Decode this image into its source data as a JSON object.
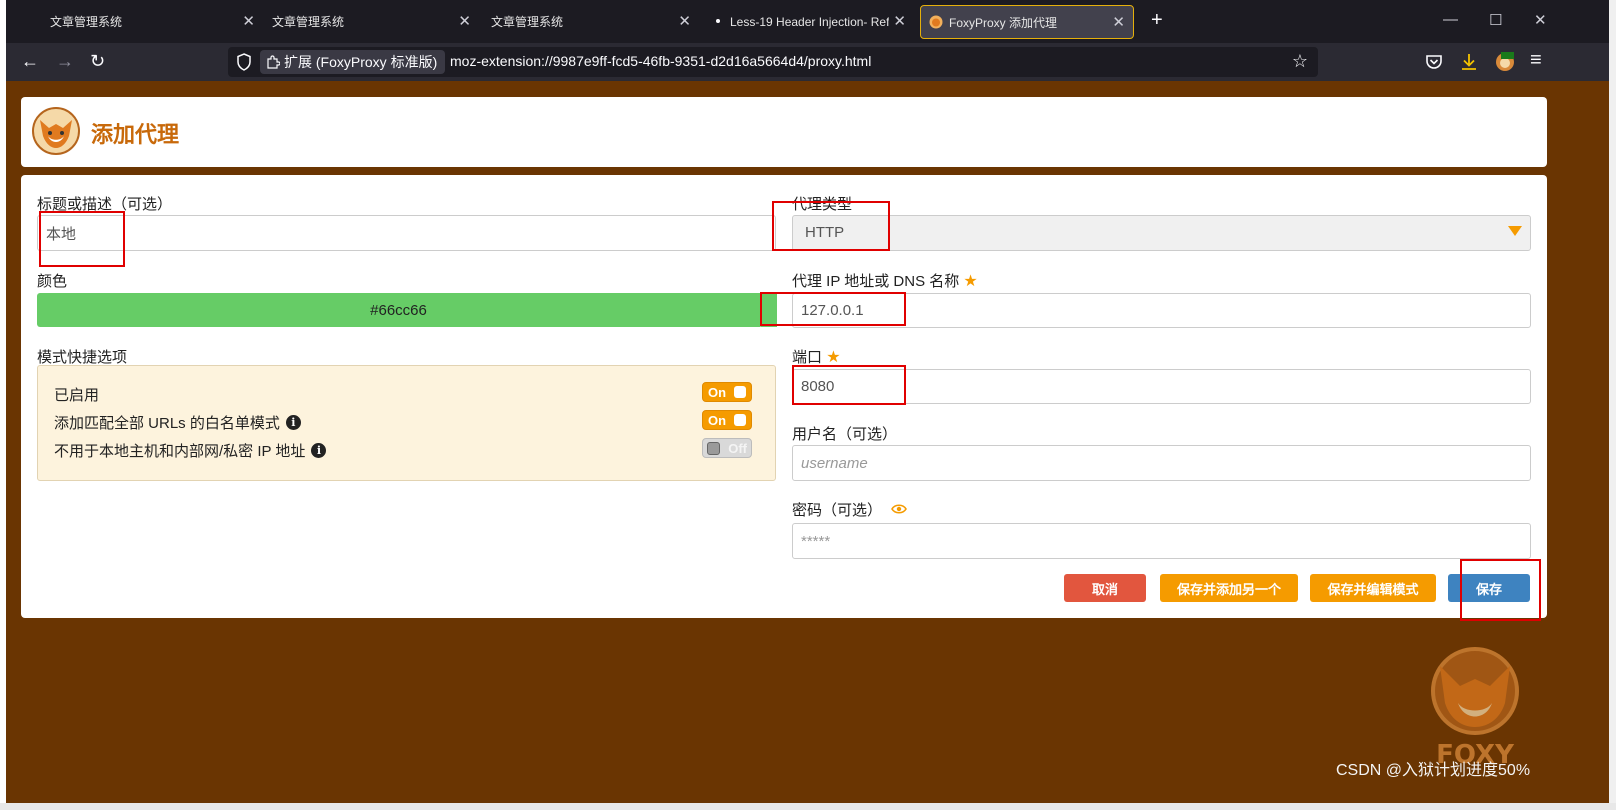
{
  "tabs": [
    {
      "title": "文章管理系统",
      "close": "✕"
    },
    {
      "title": "文章管理系统",
      "close": "✕"
    },
    {
      "title": "文章管理系统",
      "close": "✕"
    },
    {
      "title": "Less-19 Header Injection- Ref",
      "close": "✕"
    },
    {
      "title": "FoxyProxy 添加代理",
      "close": "✕"
    }
  ],
  "window": {
    "new_tab": "+",
    "minimize": "—",
    "maximize": "☐",
    "close": "✕"
  },
  "nav": {
    "back": "←",
    "forward": "→",
    "reload": "↻",
    "identity_label": "扩展 (FoxyProxy 标准版)",
    "url": "moz-extension://9987e9ff-fcd5-46fb-9351-d2d16a5664d4/proxy.html",
    "bookmark": "☆",
    "hamburger": "≡"
  },
  "header": {
    "title": "添加代理"
  },
  "form": {
    "title_label": "标题或描述（可选）",
    "title_value": "本地",
    "color_label": "颜色",
    "color_value": "#66cc66",
    "pattern_label": "模式快捷选项",
    "options": [
      {
        "label": "已启用",
        "toggle": "On"
      },
      {
        "label": "添加匹配全部 URLs 的白名单模式",
        "toggle": "On"
      },
      {
        "label": "不用于本地主机和内部网/私密 IP 地址",
        "toggle": "Off"
      }
    ],
    "type_label": "代理类型",
    "type_value": "HTTP",
    "ip_label": "代理 IP 地址或 DNS 名称",
    "ip_value": "127.0.0.1",
    "port_label": "端口",
    "port_value": "8080",
    "username_label": "用户名（可选）",
    "username_placeholder": "username",
    "password_label": "密码（可选）",
    "password_placeholder": "*****",
    "required_mark": "★",
    "info_mark": "i"
  },
  "buttons": {
    "cancel": "取消",
    "save_add": "保存并添加另一个",
    "save_edit": "保存并编辑模式",
    "save": "保存"
  },
  "watermark": {
    "csdn": "CSDN @入狱计划进度50%",
    "logo_text": "FOXY"
  },
  "colors": {
    "accent": "#f59b00",
    "page_bg": "#6a3502",
    "title": "#c8690a",
    "save": "#3e83c0",
    "cancel": "#e2563e",
    "annotation": "#e00000"
  }
}
